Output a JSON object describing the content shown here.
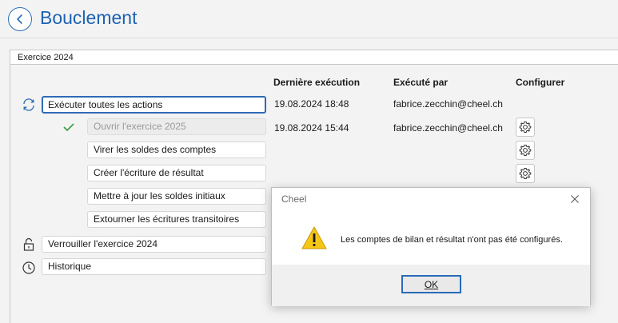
{
  "header": {
    "title": "Bouclement",
    "back_icon": "chevron-left-icon"
  },
  "group": {
    "title": "Exercice 2024"
  },
  "columns": {
    "last_run": "Dernière exécution",
    "executed_by": "Exécuté par",
    "configure": "Configurer"
  },
  "actions": {
    "run_all": {
      "label": "Exécuter toutes les actions",
      "date": "19.08.2024 18:48",
      "user": "fabrice.zecchin@cheel.ch"
    },
    "open_year": {
      "label": "Ouvrir l'exercice 2025",
      "date": "19.08.2024 15:44",
      "user": "fabrice.zecchin@cheel.ch",
      "status_icon": "check-icon"
    },
    "transfer_balances": {
      "label": "Virer les soldes des comptes"
    },
    "create_result": {
      "label": "Créer l'écriture de résultat"
    },
    "update_opening": {
      "label": "Mettre à jour les soldes initiaux"
    },
    "reverse_transitory": {
      "label": "Extourner les écritures transitoires"
    },
    "lock_year": {
      "label": "Verrouiller l'exercice 2024"
    },
    "history": {
      "label": "Historique"
    }
  },
  "dialog": {
    "title": "Cheel",
    "message": "Les comptes de bilan et résultat n'ont pas été configurés.",
    "ok_label": "OK",
    "icon": "warning-icon"
  },
  "colors": {
    "accent": "#1f62b3",
    "check": "#3a9a3a",
    "warning": "#f5c518"
  }
}
